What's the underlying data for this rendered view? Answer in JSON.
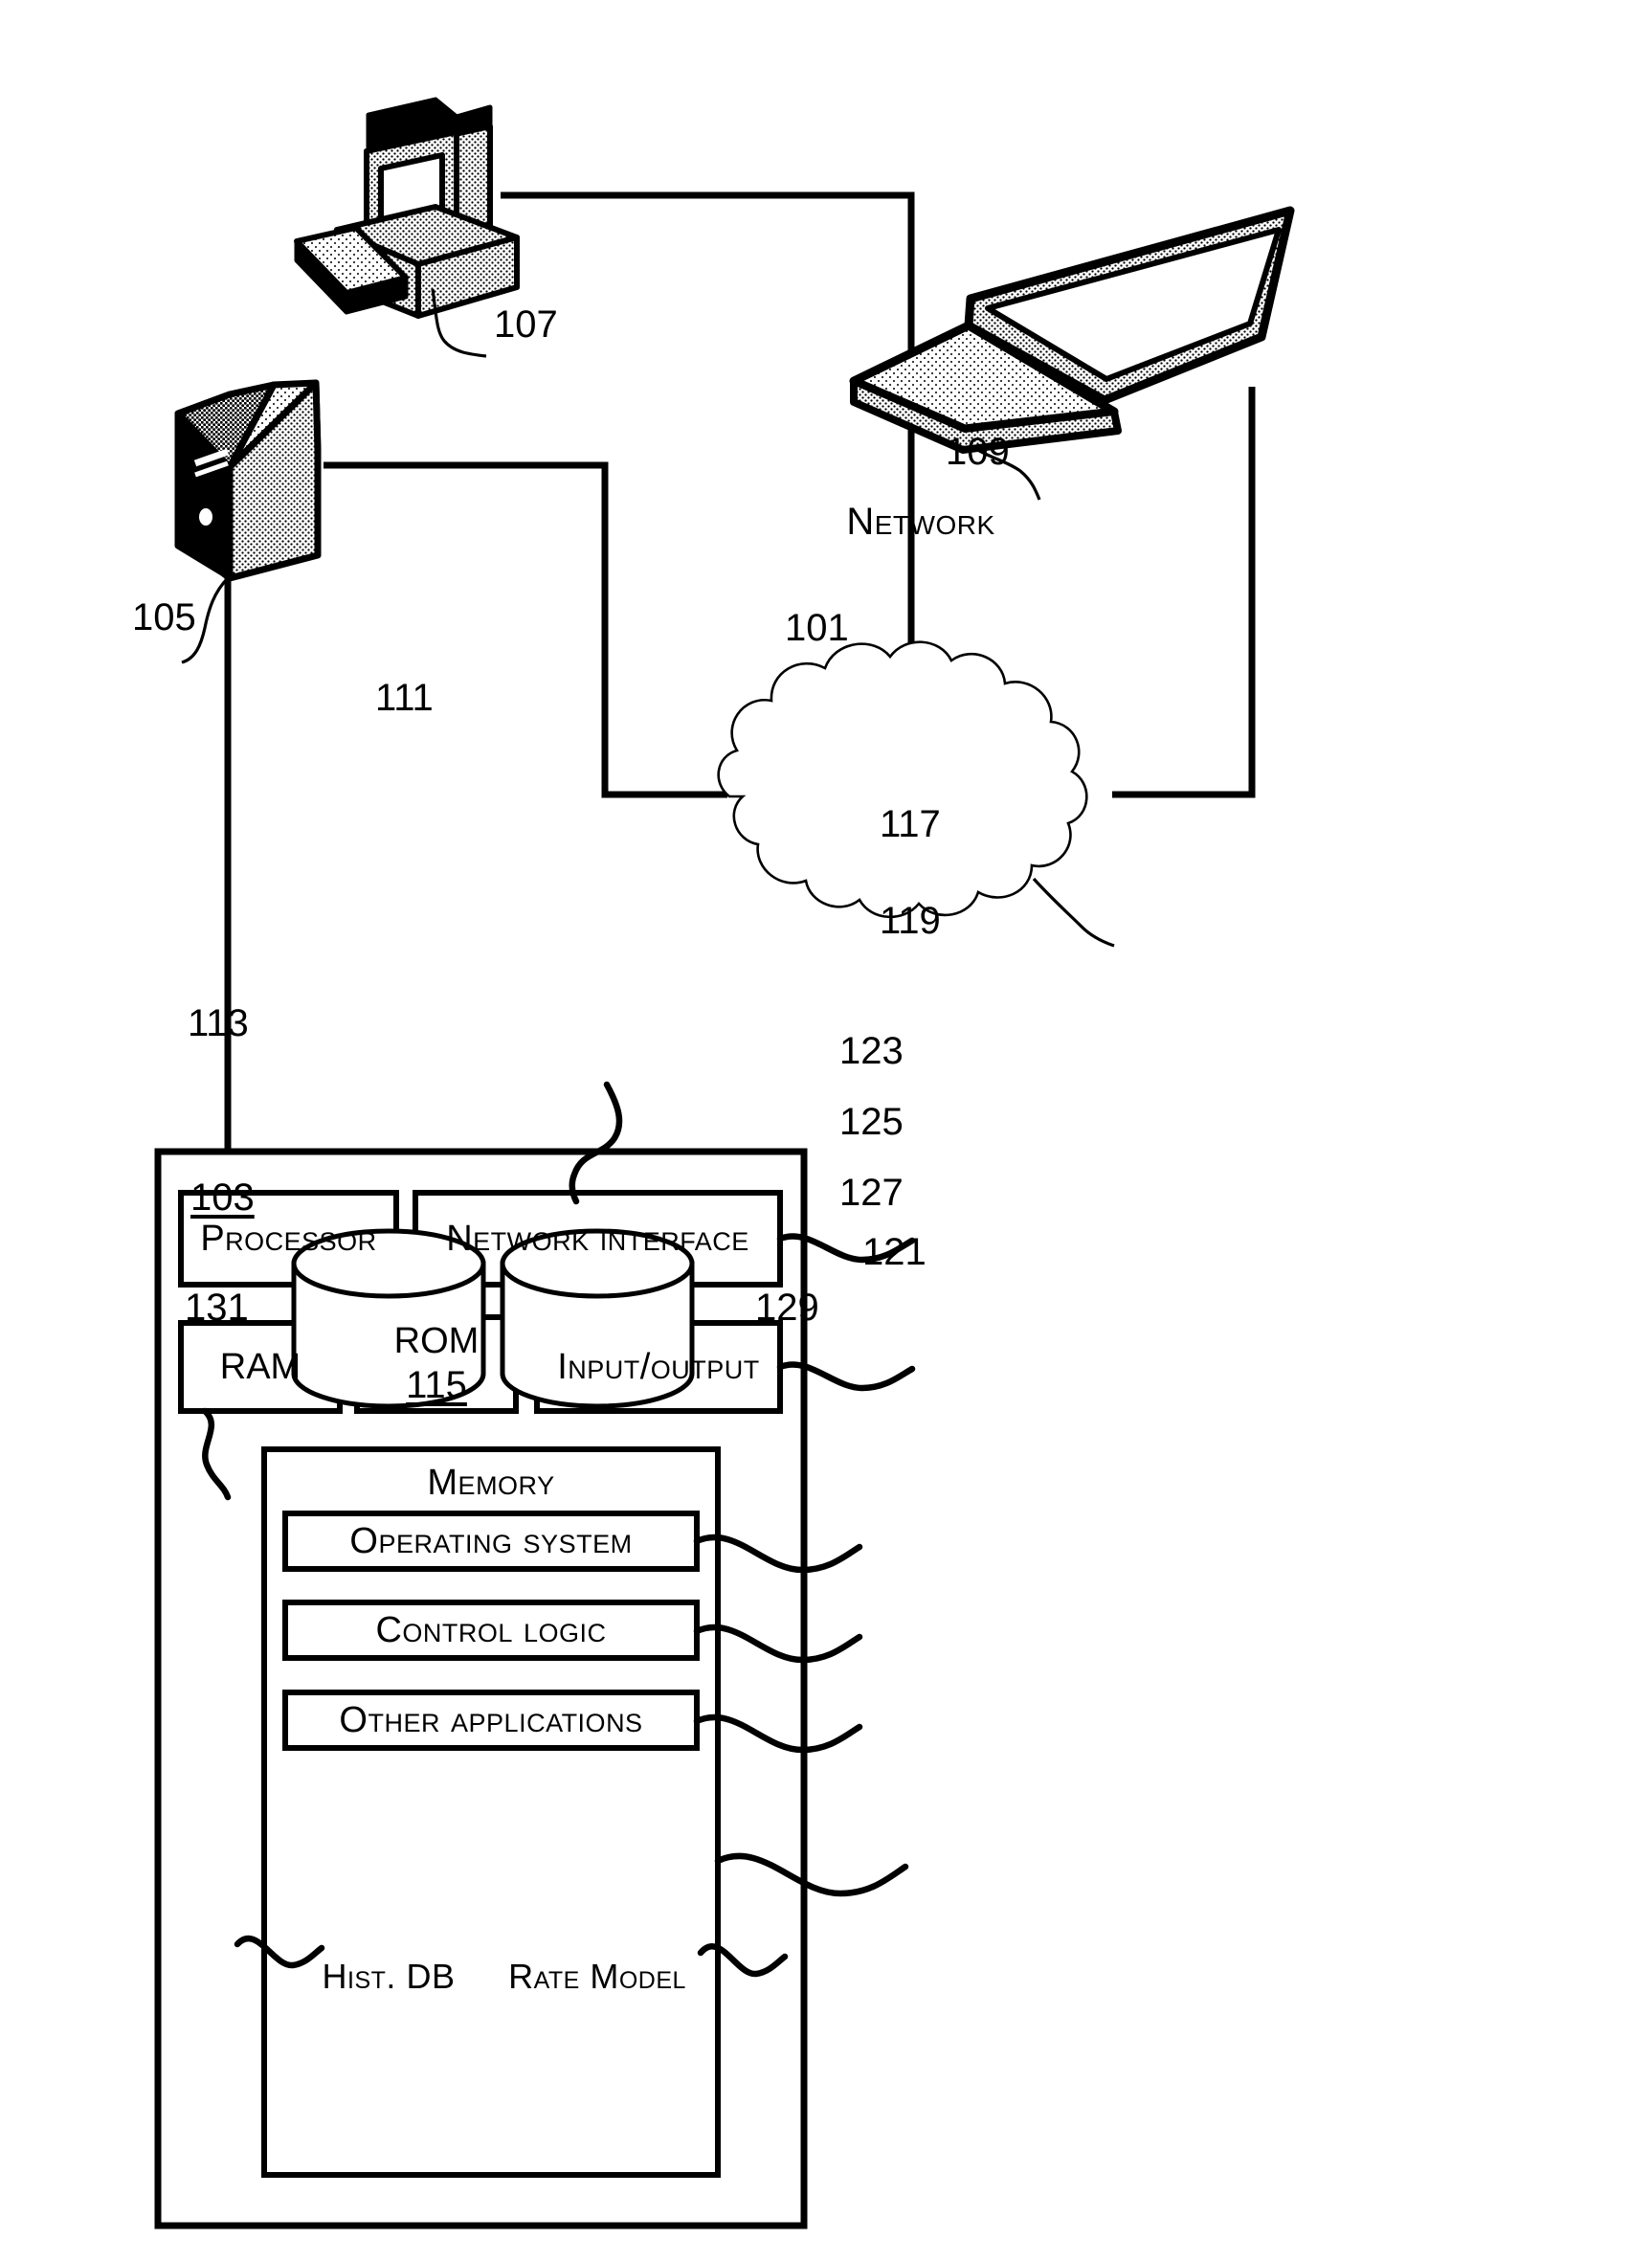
{
  "figure": {
    "type": "patent-system-block-diagram",
    "background": "#ffffff",
    "line_color": "#000000"
  },
  "network": {
    "label": "Network",
    "ref": "101"
  },
  "devices": {
    "desktop": {
      "name": "desktop-computer",
      "ref": "107"
    },
    "laptop": {
      "name": "laptop-computer",
      "ref": "109"
    },
    "server": {
      "name": "server-tower",
      "ref": "105"
    }
  },
  "system": {
    "ref": "103",
    "ref_111": "111",
    "components": [
      {
        "label": "Processor",
        "ref": "111"
      },
      {
        "label": "Network interface",
        "ref": "117"
      },
      {
        "label": "RAM",
        "ref": "113"
      },
      {
        "label": "ROM",
        "ref": "115"
      },
      {
        "label": "Input/output",
        "ref": "119"
      }
    ],
    "processor": {
      "label": "Processor"
    },
    "network_interface": {
      "label": "Network interface",
      "ref": "117"
    },
    "ram": {
      "label": "RAM",
      "ref": "113"
    },
    "rom": {
      "label": "ROM",
      "ref": "115"
    },
    "io": {
      "label": "Input/output",
      "ref": "119"
    },
    "memory": {
      "label": "Memory",
      "ref": "121",
      "items": [
        {
          "label": "Operating system",
          "ref": "123"
        },
        {
          "label": "Control logic",
          "ref": "125"
        },
        {
          "label": "Other applications",
          "ref": "127"
        }
      ],
      "databases": [
        {
          "label": "Hist. DB",
          "ref": "131"
        },
        {
          "label": "Rate Model",
          "ref": "129"
        }
      ]
    }
  },
  "reference_numerals": {
    "n101": "101",
    "n103": "103",
    "n105": "105",
    "n107": "107",
    "n109": "109",
    "n111": "111",
    "n113": "113",
    "n115": "115",
    "n117": "117",
    "n119": "119",
    "n121": "121",
    "n123": "123",
    "n125": "125",
    "n127": "127",
    "n129": "129",
    "n131": "131"
  }
}
